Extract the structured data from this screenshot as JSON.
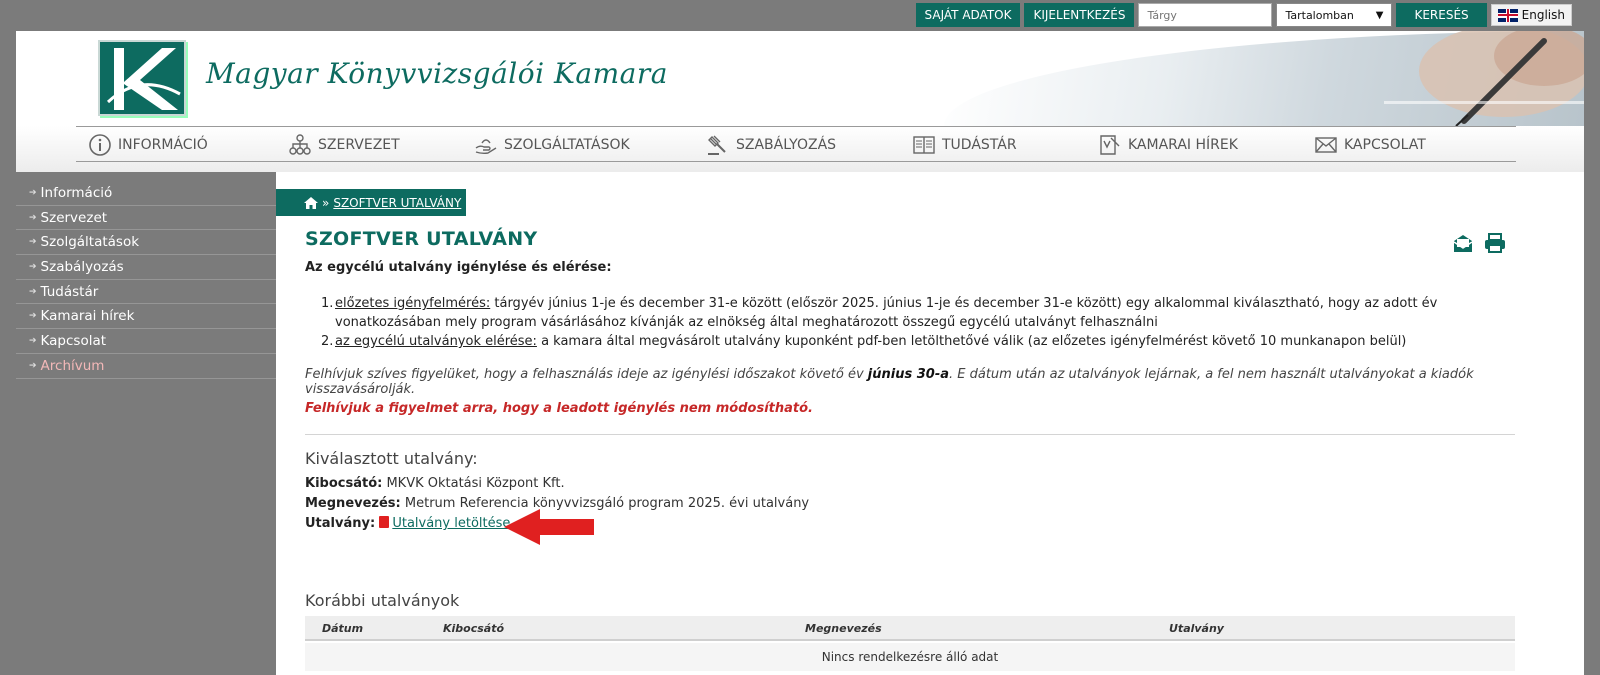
{
  "topbar": {
    "sajat_adatok": "SAJÁT ADATOK",
    "kijelentkezes": "KIJELENTKEZÉS",
    "search_placeholder": "Tárgy",
    "scope_selected": "Tartalomban",
    "search_button": "KERESÉS",
    "language": "English"
  },
  "header": {
    "site_name": "Magyar Könyvvizsgálói Kamara"
  },
  "nav": {
    "items": [
      {
        "label": "INFORMÁCIÓ",
        "icon": "info-icon"
      },
      {
        "label": "SZERVEZET",
        "icon": "org-chart-icon"
      },
      {
        "label": "SZOLGÁLTATÁSOK",
        "icon": "hand-service-icon"
      },
      {
        "label": "SZABÁLYOZÁS",
        "icon": "gavel-icon"
      },
      {
        "label": "TUDÁSTÁR",
        "icon": "book-icon"
      },
      {
        "label": "KAMARAI HÍREK",
        "icon": "news-icon"
      },
      {
        "label": "KAPCSOLAT",
        "icon": "envelope-icon"
      }
    ]
  },
  "sidebar": {
    "items": [
      {
        "label": "Információ"
      },
      {
        "label": "Szervezet"
      },
      {
        "label": "Szolgáltatások"
      },
      {
        "label": "Szabályozás"
      },
      {
        "label": "Tudástár"
      },
      {
        "label": "Kamarai hírek"
      },
      {
        "label": "Kapcsolat"
      },
      {
        "label": "Archívum"
      }
    ]
  },
  "content": {
    "breadcrumb_sep": "»",
    "breadcrumb": "SZOFTVER UTALVÁNY",
    "title": "SZOFTVER UTALVÁNY",
    "subtitle": "Az egycélú utalvány igénylése és elérése:",
    "list": [
      {
        "num": "1.",
        "label": "előzetes igényfelmérés:",
        "text": " tárgyév június 1-je és december 31-e között (először 2025. június 1-je és december 31-e között) egy alkalommal kiválasztható, hogy az adott év vonatkozásában mely program vásárlásához kívánják az elnökség által meghatározott összegű egycélú utalványt felhasználni"
      },
      {
        "num": "2.",
        "label": "az egycélú utalványok elérése:",
        "text": " a kamara által megvásárolt utalvány kuponként pdf-ben letölthetővé válik (az előzetes igényfelmérést követő 10 munkanapon belül)"
      }
    ],
    "note_pre": "Felhívjuk szíves figyelüket, hogy a felhasználás ideje az igénylési időszakot követő év ",
    "note_bold": "június 30-a",
    "note_post": ". E dátum után az utalványok lejárnak, a fel nem használt utalványokat a kiadók visszavásárolják.",
    "warning": "Felhívjuk a figyelmet arra, hogy a leadott igénylés nem módosítható.",
    "selected_title": "Kiválasztott utalvány:",
    "kibocsato_label": "Kibocsátó:",
    "kibocsato_value": " MKVK Oktatási Központ Kft.",
    "megnevezes_label": "Megnevezés:",
    "megnevezes_value": " Metrum Referencia könyvvizsgáló program 2025. évi utalvány",
    "utalvany_label": "Utalvány:",
    "download_link": "Utalvány letöltése",
    "previous_title": "Korábbi utalványok",
    "table_headers": [
      "Dátum",
      "Kibocsátó",
      "Megnevezés",
      "Utalvány"
    ],
    "table_empty": "Nincs rendelkezésre álló adat"
  },
  "colors": {
    "brand": "#0d6b60",
    "warning": "#c62828",
    "arrow": "#e02020"
  }
}
